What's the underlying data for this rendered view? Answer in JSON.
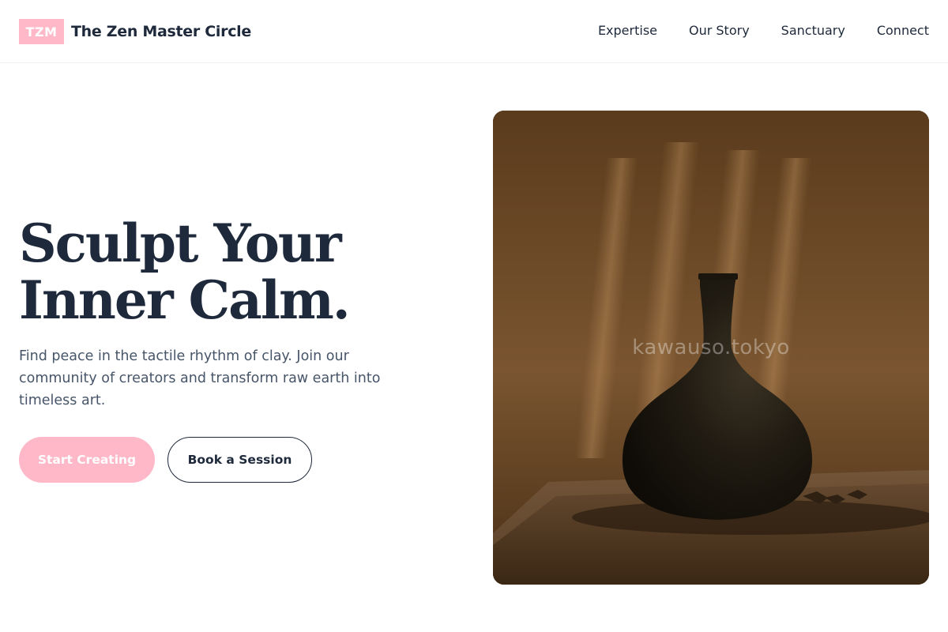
{
  "header": {
    "logo_text": "TZM",
    "brand_name": "The Zen Master Circle",
    "nav": [
      "Expertise",
      "Our Story",
      "Sanctuary",
      "Connect"
    ]
  },
  "hero": {
    "title_line1": "Sculpt Your",
    "title_line2": "Inner Calm.",
    "subtitle": "Find peace in the tactile rhythm of clay. Join our community of creators and transform raw earth into timeless art.",
    "primary_cta": "Start Creating",
    "secondary_cta": "Book a Session",
    "image_watermark": "kawauso.tokyo"
  },
  "colors": {
    "accent": "#ffb8c8",
    "text_dark": "#1e293b",
    "text_muted": "#475569"
  }
}
